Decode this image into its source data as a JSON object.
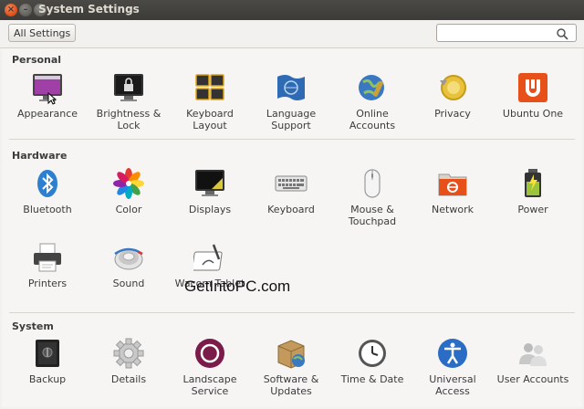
{
  "window": {
    "title": "System Settings"
  },
  "toolbar": {
    "all_settings_label": "All Settings",
    "search_placeholder": ""
  },
  "sections": {
    "personal": {
      "title": "Personal",
      "items": [
        {
          "label": "Appearance",
          "icon": "appearance-icon"
        },
        {
          "label": "Brightness &",
          "label2": "Lock",
          "icon": "lock-monitor-icon"
        },
        {
          "label": "Keyboard",
          "label2": "Layout",
          "icon": "keyboard-layout-icon"
        },
        {
          "label": "Language",
          "label2": "Support",
          "icon": "language-flag-icon"
        },
        {
          "label": "Online",
          "label2": "Accounts",
          "icon": "online-accounts-icon"
        },
        {
          "label": "Privacy",
          "icon": "privacy-icon"
        },
        {
          "label": "Ubuntu One",
          "icon": "ubuntu-one-icon"
        }
      ]
    },
    "hardware": {
      "title": "Hardware",
      "items": [
        {
          "label": "Bluetooth",
          "icon": "bluetooth-icon"
        },
        {
          "label": "Color",
          "icon": "color-icon"
        },
        {
          "label": "Displays",
          "icon": "display-icon"
        },
        {
          "label": "Keyboard",
          "icon": "keyboard-icon"
        },
        {
          "label": "Mouse &",
          "label2": "Touchpad",
          "icon": "mouse-icon"
        },
        {
          "label": "Network",
          "icon": "network-icon"
        },
        {
          "label": "Power",
          "icon": "battery-icon"
        },
        {
          "label": "Printers",
          "icon": "printer-icon"
        },
        {
          "label": "Sound",
          "icon": "speaker-icon"
        },
        {
          "label": "Wacom Tablet",
          "icon": "wacom-tablet-icon"
        }
      ]
    },
    "system": {
      "title": "System",
      "items": [
        {
          "label": "Backup",
          "icon": "backup-safe-icon"
        },
        {
          "label": "Details",
          "icon": "gear-icon"
        },
        {
          "label": "Landscape",
          "label2": "Service",
          "icon": "landscape-icon"
        },
        {
          "label": "Software &",
          "label2": "Updates",
          "icon": "software-box-icon"
        },
        {
          "label": "Time & Date",
          "icon": "clock-icon"
        },
        {
          "label": "Universal",
          "label2": "Access",
          "icon": "universal-access-icon"
        },
        {
          "label": "User Accounts",
          "icon": "users-icon"
        }
      ]
    }
  },
  "watermark": "GetIntoPC.com",
  "colors": {
    "titlebar": "#3c3b37",
    "close_button": "#e2531c",
    "ubuntu_one": "#e8501a",
    "landscape": "#7a1b4a"
  }
}
